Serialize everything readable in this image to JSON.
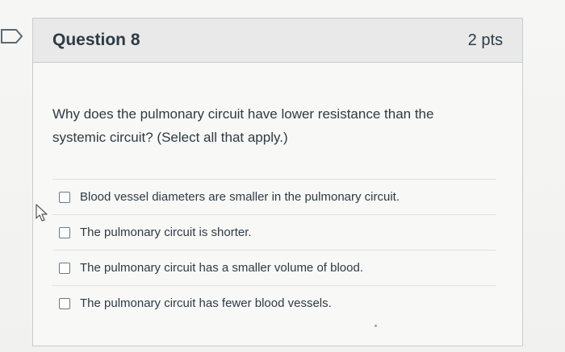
{
  "question": {
    "title": "Question 8",
    "points": "2 pts",
    "text": "Why does the pulmonary circuit have lower resistance than the systemic circuit? (Select all that apply.)",
    "answers": [
      "Blood vessel diameters are smaller in the pulmonary circuit.",
      "The pulmonary circuit is shorter.",
      "The pulmonary circuit has a smaller volume of blood.",
      "The pulmonary circuit has fewer blood vessels."
    ]
  },
  "icons": {
    "flag": "flag-icon",
    "cursor": "mouse-pointer-icon"
  },
  "colors": {
    "text": "#2d3b45",
    "header_bg": "#e8e9e8",
    "border": "#c7cdd1"
  }
}
